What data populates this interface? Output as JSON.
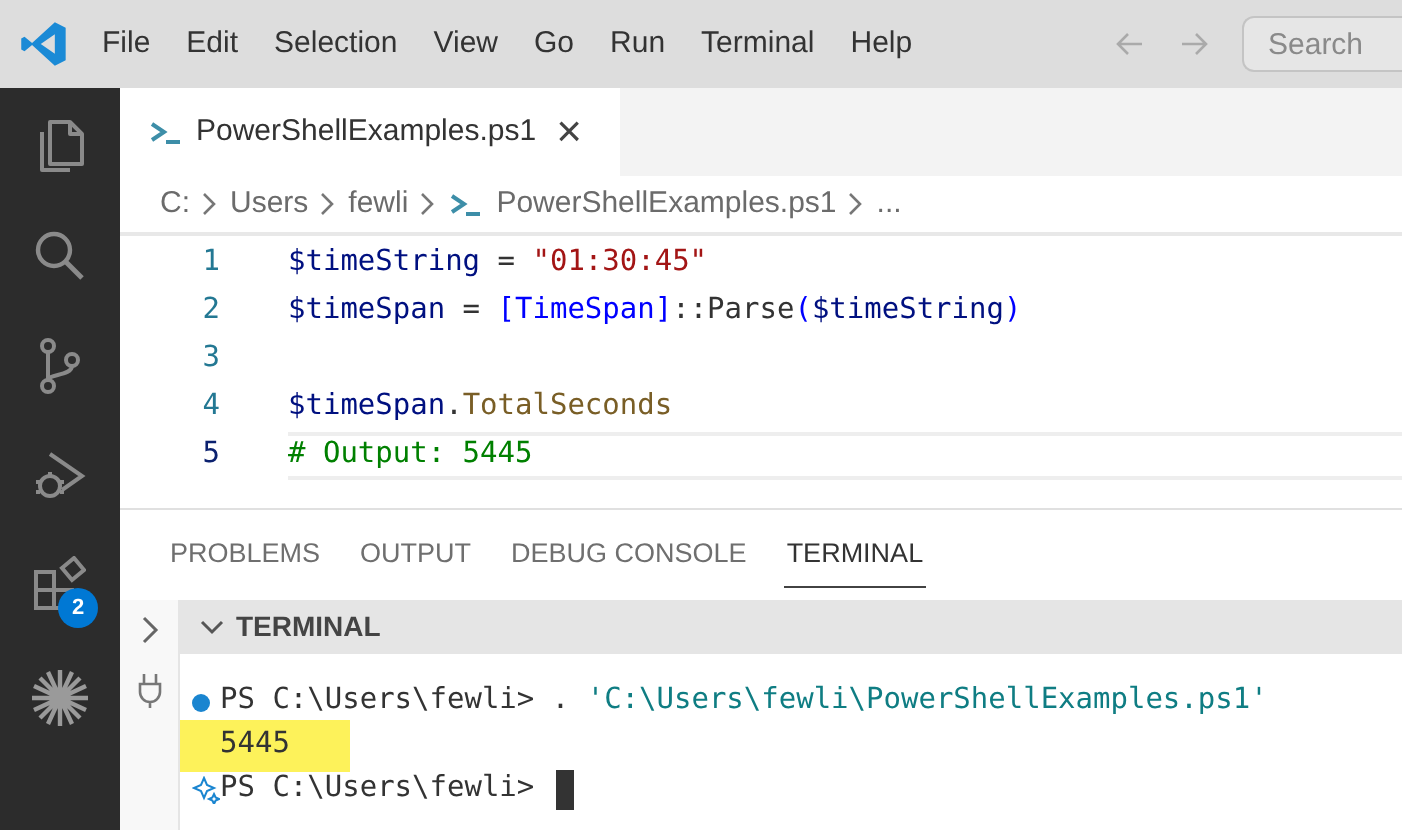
{
  "menu": [
    "File",
    "Edit",
    "Selection",
    "View",
    "Go",
    "Run",
    "Terminal",
    "Help"
  ],
  "search": {
    "placeholder": "Search"
  },
  "activity_bar": {
    "extensions_badge": "2"
  },
  "tabs": [
    {
      "label": "PowerShellExamples.ps1",
      "selected": true,
      "close": "×"
    }
  ],
  "breadcrumb": [
    {
      "text": "C:",
      "kind": "plain"
    },
    {
      "text": "Users",
      "kind": "plain"
    },
    {
      "text": "fewli",
      "kind": "plain"
    },
    {
      "text": "PowerShellExamples.ps1",
      "kind": "file"
    },
    {
      "text": "...",
      "kind": "plain"
    }
  ],
  "code": [
    {
      "number": "1",
      "current": false,
      "tokens": [
        {
          "text": "$timeString",
          "kind": "var"
        },
        {
          "text": " = ",
          "kind": "plain"
        },
        {
          "text": "\"01:30:45\"",
          "kind": "string"
        }
      ]
    },
    {
      "number": "2",
      "current": false,
      "tokens": [
        {
          "text": "$timeSpan",
          "kind": "var"
        },
        {
          "text": " = ",
          "kind": "plain"
        },
        {
          "text": "[TimeSpan]",
          "kind": "type"
        },
        {
          "text": "::Parse",
          "kind": "plain"
        },
        {
          "text": "(",
          "kind": "type"
        },
        {
          "text": "$timeString",
          "kind": "var"
        },
        {
          "text": ")",
          "kind": "type"
        }
      ]
    },
    {
      "number": "3",
      "current": false
    },
    {
      "number": "4",
      "current": false,
      "tokens": [
        {
          "text": "$timeSpan",
          "kind": "var"
        },
        {
          "text": ".",
          "kind": "plain"
        },
        {
          "text": "TotalSeconds",
          "kind": "member"
        }
      ]
    },
    {
      "number": "5",
      "current": true,
      "tokens": [
        {
          "text": "# Output: 5445",
          "kind": "comment"
        }
      ]
    }
  ],
  "panel_tabs": [
    {
      "label": "PROBLEMS",
      "selected": false
    },
    {
      "label": "OUTPUT",
      "selected": false
    },
    {
      "label": "DEBUG CONSOLE",
      "selected": false
    },
    {
      "label": "TERMINAL",
      "selected": true
    }
  ],
  "terminal": {
    "title": "TERMINAL",
    "lines": [
      {
        "kind": "command",
        "prompt": "PS C:\\Users\\fewli> ",
        "command": ". ",
        "argument": "'C:\\Users\\fewli\\PowerShellExamples.ps1'"
      },
      {
        "kind": "output",
        "text": "5445",
        "highlighted": true
      },
      {
        "kind": "prompt",
        "prompt": "PS C:\\Users\\fewli> ",
        "cursor": true
      }
    ]
  }
}
